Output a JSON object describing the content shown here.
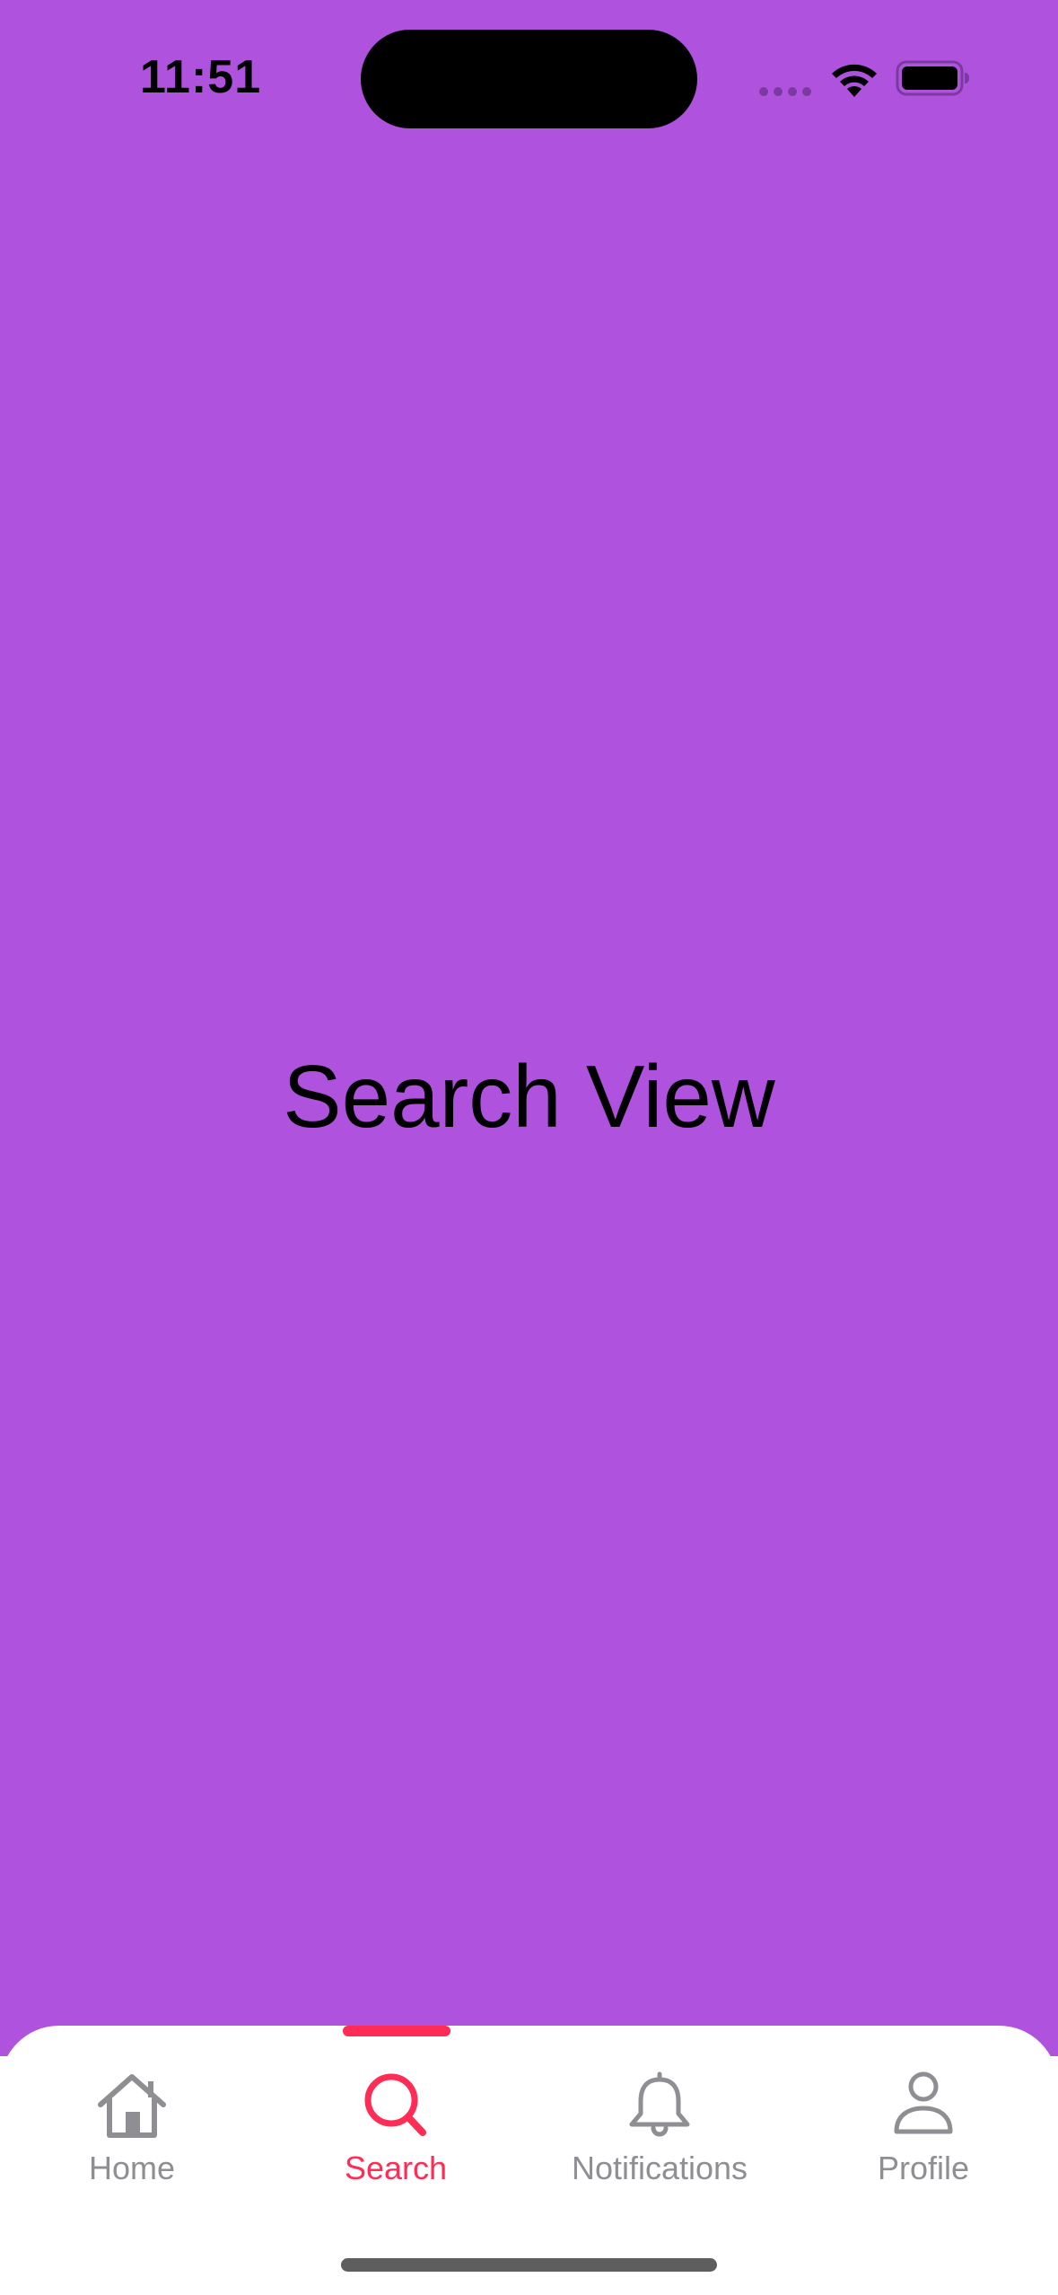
{
  "status_bar": {
    "time": "11:51"
  },
  "main": {
    "title": "Search View",
    "background_color": "#AF52DE"
  },
  "tab_bar": {
    "active_color": "#FF2D55",
    "inactive_color": "#8E8E93",
    "active_tab": "search",
    "tabs": [
      {
        "id": "home",
        "label": "Home",
        "icon": "house-icon"
      },
      {
        "id": "search",
        "label": "Search",
        "icon": "magnifying-glass-icon"
      },
      {
        "id": "notifications",
        "label": "Notifications",
        "icon": "bell-icon"
      },
      {
        "id": "profile",
        "label": "Profile",
        "icon": "person-icon"
      }
    ]
  }
}
